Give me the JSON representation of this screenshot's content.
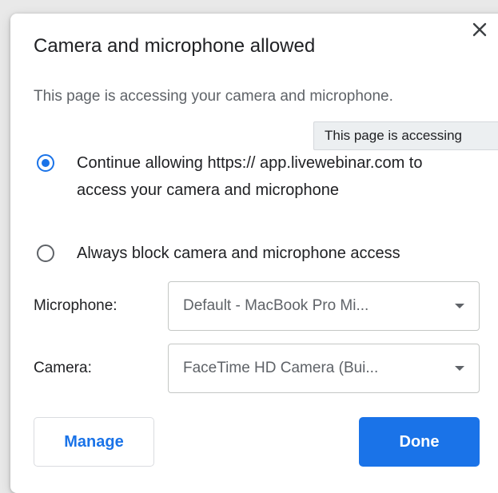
{
  "dialog": {
    "title": "Camera and microphone allowed",
    "description": "This page is accessing your camera and microphone.",
    "close_icon": "close-icon"
  },
  "tooltip": {
    "text": "This page is accessing"
  },
  "options": [
    {
      "label": "Continue allowing https:// app.livewebinar.com to access your camera and microphone",
      "checked": true
    },
    {
      "label": "Always block camera and microphone access",
      "checked": false
    }
  ],
  "microphone": {
    "label": "Microphone:",
    "selected": "Default - MacBook Pro Mi..."
  },
  "camera": {
    "label": "Camera:",
    "selected": "FaceTime HD Camera (Bui..."
  },
  "buttons": {
    "manage_label": "Manage",
    "done_label": "Done"
  },
  "colors": {
    "accent": "#1a73e8",
    "text": "#202124",
    "secondary_text": "#5f6368"
  }
}
